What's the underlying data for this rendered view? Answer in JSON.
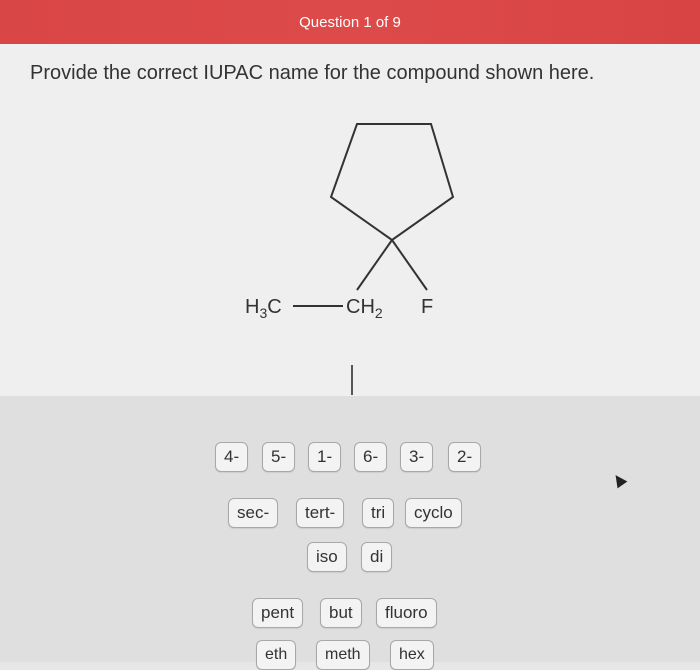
{
  "header": {
    "title": "Question 1 of 9"
  },
  "question": {
    "prompt": "Provide the correct IUPAC name for the compound shown here."
  },
  "molecule": {
    "left_group": "H",
    "left_sub": "3",
    "left_c": "C",
    "ch2": "CH",
    "ch2_sub": "2",
    "f": "F"
  },
  "tiles": {
    "row1": [
      "4-",
      "5-",
      "1-",
      "6-",
      "3-",
      "2-"
    ],
    "row2": [
      "sec-",
      "tert-",
      "tri",
      "cyclo"
    ],
    "row3": [
      "iso",
      "di"
    ],
    "row4": [
      "pent",
      "but",
      "fluoro"
    ],
    "row5": [
      "eth",
      "meth",
      "hex"
    ]
  }
}
